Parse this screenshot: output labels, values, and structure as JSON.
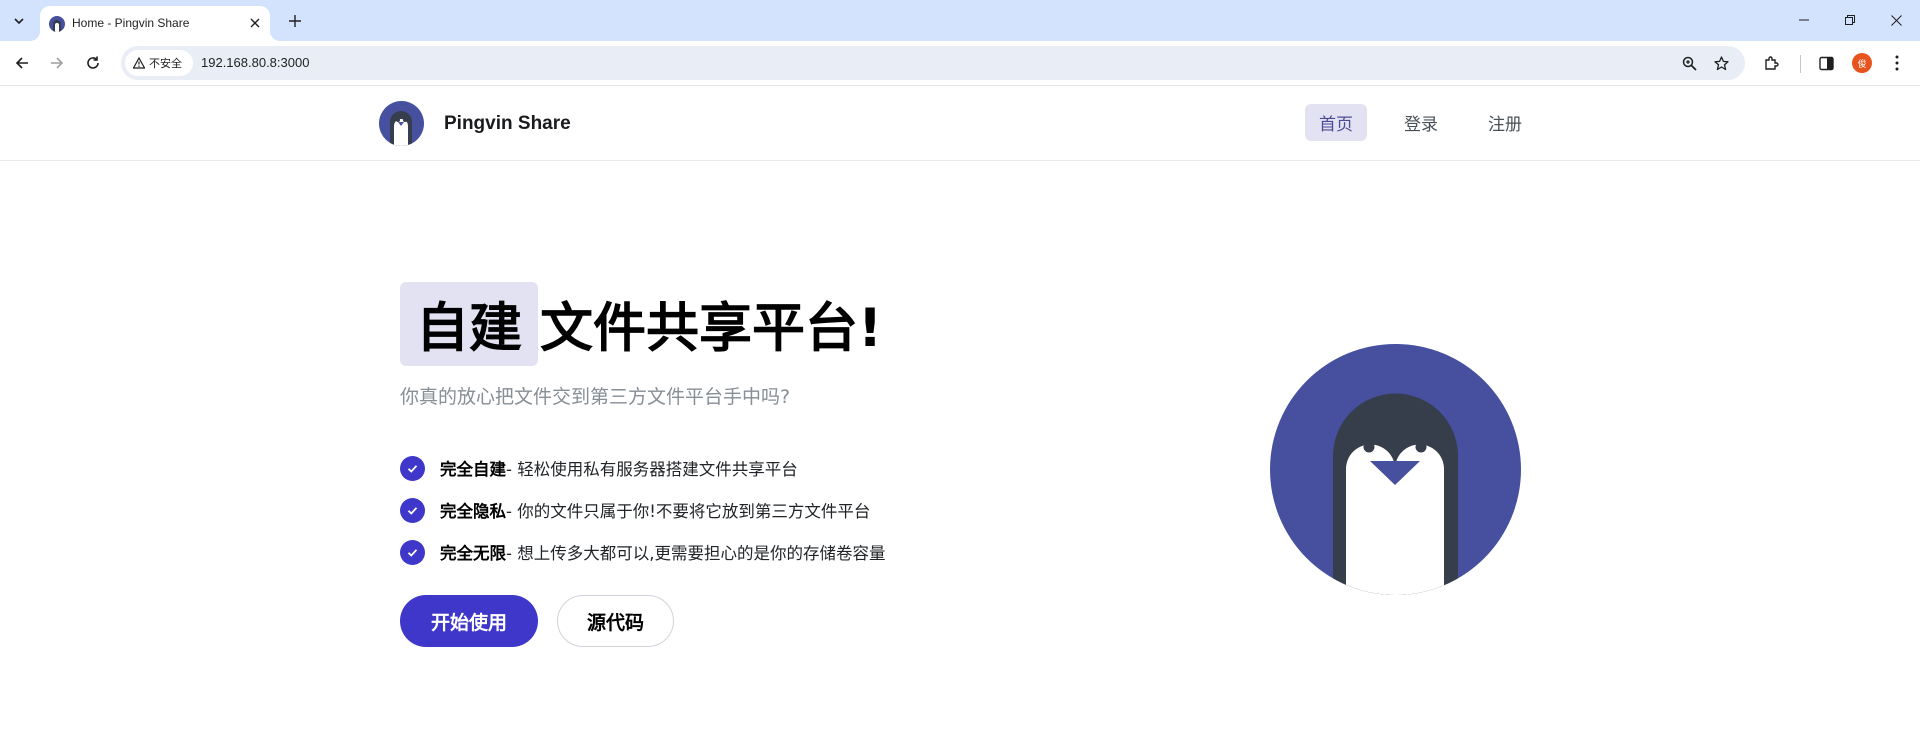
{
  "browser": {
    "tab_title": "Home - Pingvin Share",
    "security_label": "不安全",
    "url": "192.168.80.8:3000",
    "profile_initial": "俊"
  },
  "header": {
    "brand": "Pingvin Share",
    "nav": [
      {
        "label": "首页",
        "active": true
      },
      {
        "label": "登录",
        "active": false
      },
      {
        "label": "注册",
        "active": false
      }
    ]
  },
  "hero": {
    "title_highlight": "自建",
    "title_rest": "文件共享平台!",
    "subtitle": "你真的放心把文件交到第三方文件平台手中吗?",
    "features": [
      {
        "title": "完全自建",
        "desc": " - 轻松使用私有服务器搭建文件共享平台"
      },
      {
        "title": "完全隐私",
        "desc": " - 你的文件只属于你!不要将它放到第三方文件平台"
      },
      {
        "title": "完全无限",
        "desc": " - 想上传多大都可以,更需要担心的是你的存储卷容量"
      }
    ],
    "primary_button": "开始使用",
    "secondary_button": "源代码"
  },
  "colors": {
    "accent": "#3f37c9",
    "logo_bg": "#46509e",
    "penguin_dark": "#353e4a",
    "nav_active_bg": "#e3e2f3"
  },
  "icons": [
    "tab-search-icon",
    "favicon-icon",
    "close-icon",
    "plus-icon",
    "minimize-icon",
    "restore-icon",
    "back-icon",
    "forward-icon",
    "reload-icon",
    "warning-icon",
    "zoom-icon",
    "star-icon",
    "extensions-icon",
    "side-panel-icon",
    "more-icon",
    "check-icon",
    "penguin-logo"
  ]
}
